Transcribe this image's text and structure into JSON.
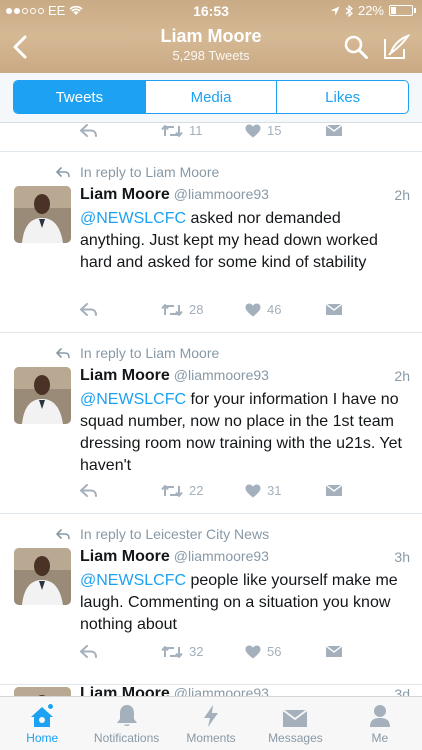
{
  "status": {
    "carrier": "EE",
    "time": "16:53",
    "battery": "22%"
  },
  "header": {
    "title": "Liam Moore",
    "subtitle": "5,298 Tweets"
  },
  "tabs": [
    {
      "label": "Tweets",
      "active": true
    },
    {
      "label": "Media",
      "active": false
    },
    {
      "label": "Likes",
      "active": false
    }
  ],
  "top_stub": {
    "retweets": "11",
    "likes": "15"
  },
  "tweets": [
    {
      "reply_to": "In reply to Liam Moore",
      "name": "Liam Moore",
      "handle": "@liammoore93",
      "time": "2h",
      "mention": "@NEWSLCFC",
      "text": " asked nor demanded anything. Just kept my head down worked hard and asked for some kind of stability",
      "retweets": "28",
      "likes": "46"
    },
    {
      "reply_to": "In reply to Liam Moore",
      "name": "Liam Moore",
      "handle": "@liammoore93",
      "time": "2h",
      "mention": "@NEWSLCFC",
      "text": " for your information I have no squad number, now no place in the 1st team dressing room now training with the u21s. Yet haven't",
      "retweets": "22",
      "likes": "31"
    },
    {
      "reply_to": "In reply to Leicester City News",
      "name": "Liam Moore",
      "handle": "@liammoore93",
      "time": "3h",
      "mention": "@NEWSLCFC",
      "text": " people like yourself make me laugh. Commenting on a situation you know nothing about",
      "retweets": "32",
      "likes": "56"
    }
  ],
  "partial_tweet": {
    "name": "Liam Moore",
    "handle": "@liammoore93",
    "time": "3d"
  },
  "tabbar": [
    {
      "label": "Home",
      "icon": "home-icon",
      "active": true
    },
    {
      "label": "Notifications",
      "icon": "bell-icon",
      "active": false
    },
    {
      "label": "Moments",
      "icon": "lightning-icon",
      "active": false
    },
    {
      "label": "Messages",
      "icon": "envelope-icon",
      "active": false
    },
    {
      "label": "Me",
      "icon": "person-icon",
      "active": false
    }
  ],
  "colors": {
    "accent": "#1da1f2",
    "header_tan": "#d5b994",
    "muted": "#8899a6"
  }
}
